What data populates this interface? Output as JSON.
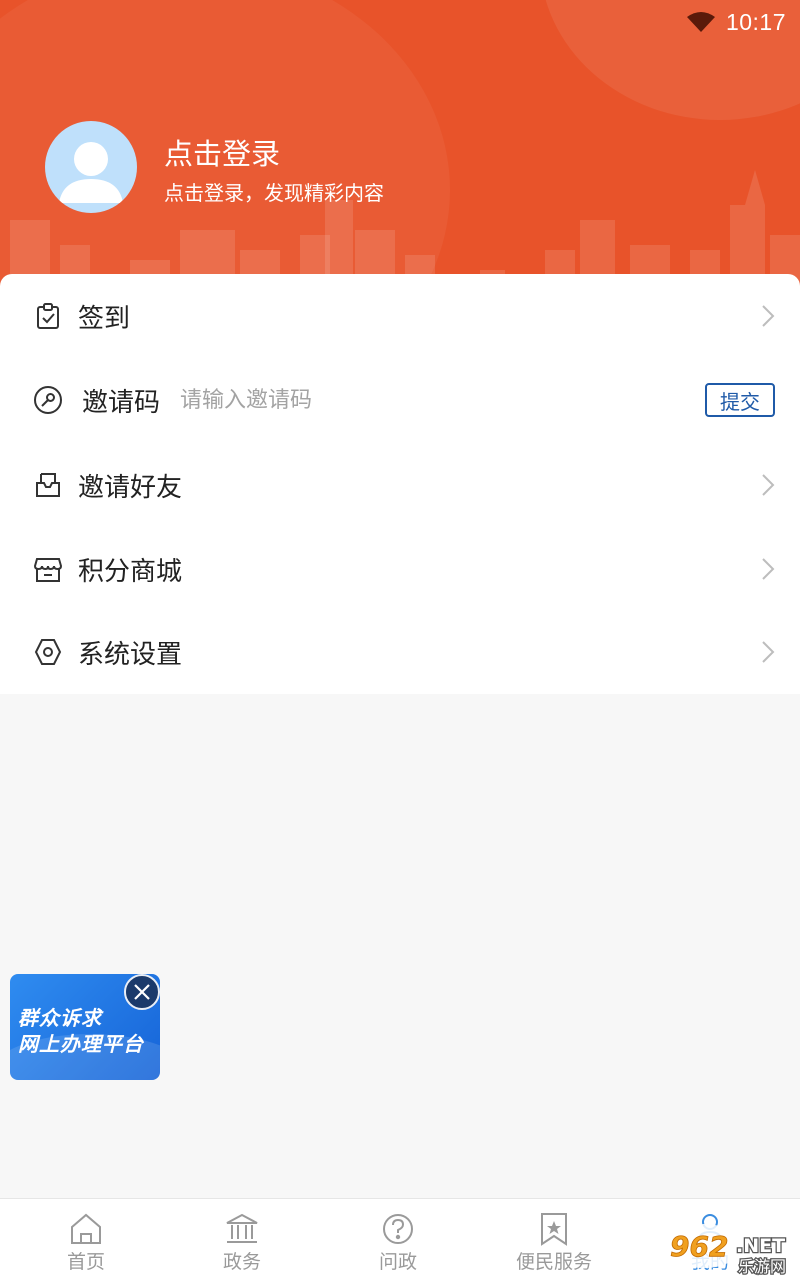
{
  "status_bar": {
    "time": "10:17"
  },
  "header": {
    "login_title": "点击登录",
    "login_subtitle": "点击登录，发现精彩内容",
    "brand_color": "#e8532a"
  },
  "menu": {
    "checkin_label": "签到",
    "invite_code_label": "邀请码",
    "invite_code_placeholder": "请输入邀请码",
    "invite_code_value": "",
    "submit_label": "提交",
    "invite_friends_label": "邀请好友",
    "points_mall_label": "积分商城",
    "settings_label": "系统设置"
  },
  "float_banner": {
    "line1": "群众诉求",
    "line2": "网上办理平台"
  },
  "bottom_nav": {
    "items": [
      {
        "label": "首页",
        "icon": "home-icon"
      },
      {
        "label": "政务",
        "icon": "government-building-icon"
      },
      {
        "label": "问政",
        "icon": "question-circle-icon"
      },
      {
        "label": "便民服务",
        "icon": "bookmark-star-icon"
      },
      {
        "label": "我的",
        "icon": "user-icon"
      }
    ]
  },
  "watermark": {
    "text1": "962",
    "text2": ".NET",
    "text3": "乐游网"
  }
}
